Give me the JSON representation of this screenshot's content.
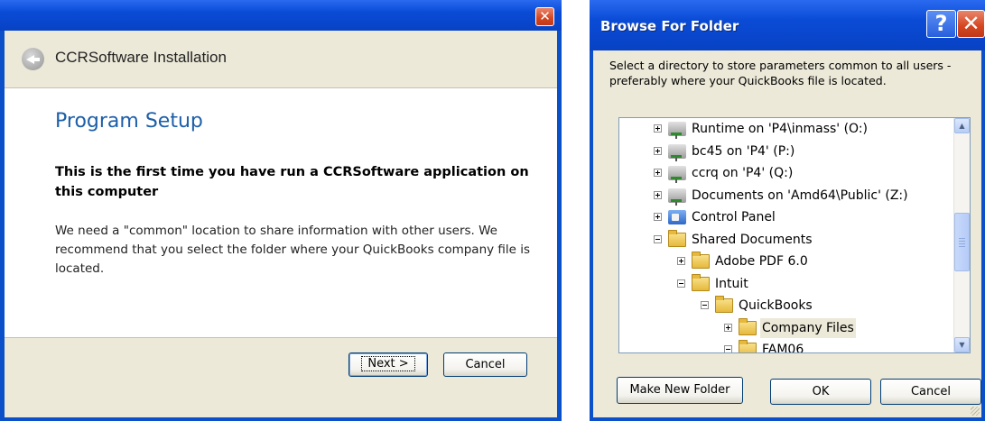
{
  "installer": {
    "header_title": "CCRSoftware Installation",
    "page_title": "Program Setup",
    "bold_line": "This is the first time you have run a CCRSoftware application on this computer",
    "body": "We need a \"common\" location to share information with other users. We recommend that you select the folder where your QuickBooks company file is located.",
    "next_label": "Next >",
    "cancel_label": "Cancel",
    "close_glyph": "✕"
  },
  "browse": {
    "title": "Browse For Folder",
    "help_glyph": "?",
    "close_glyph": "✕",
    "instructions": "Select a directory to store parameters common to all users - preferably where your QuickBooks file is located.",
    "tree": [
      {
        "label": "Runtime on 'P4\\inmass' (O:)",
        "icon": "network-drive-icon",
        "expander": "plus",
        "level": 0
      },
      {
        "label": "bc45 on 'P4' (P:)",
        "icon": "network-drive-icon",
        "expander": "plus",
        "level": 0
      },
      {
        "label": "ccrq on 'P4' (Q:)",
        "icon": "network-drive-icon",
        "expander": "plus",
        "level": 0
      },
      {
        "label": "Documents on 'Amd64\\Public' (Z:)",
        "icon": "network-drive-icon",
        "expander": "plus",
        "level": 0
      },
      {
        "label": "Control Panel",
        "icon": "control-panel-icon",
        "expander": "plus",
        "level": 0
      },
      {
        "label": "Shared Documents",
        "icon": "open-folder-icon",
        "expander": "minus",
        "level": 0
      },
      {
        "label": "Adobe PDF 6.0",
        "icon": "folder-icon",
        "expander": "plus",
        "level": 1
      },
      {
        "label": "Intuit",
        "icon": "open-folder-icon",
        "expander": "minus",
        "level": 1
      },
      {
        "label": "QuickBooks",
        "icon": "open-folder-icon",
        "expander": "minus",
        "level": 2
      },
      {
        "label": "Company Files",
        "icon": "folder-icon",
        "expander": "plus",
        "level": 3,
        "selected": true
      },
      {
        "label": "FAM06",
        "icon": "folder-icon",
        "expander": "minus",
        "level": 3
      }
    ],
    "make_new_folder_label": "Make New Folder",
    "ok_label": "OK",
    "cancel_label": "Cancel"
  }
}
